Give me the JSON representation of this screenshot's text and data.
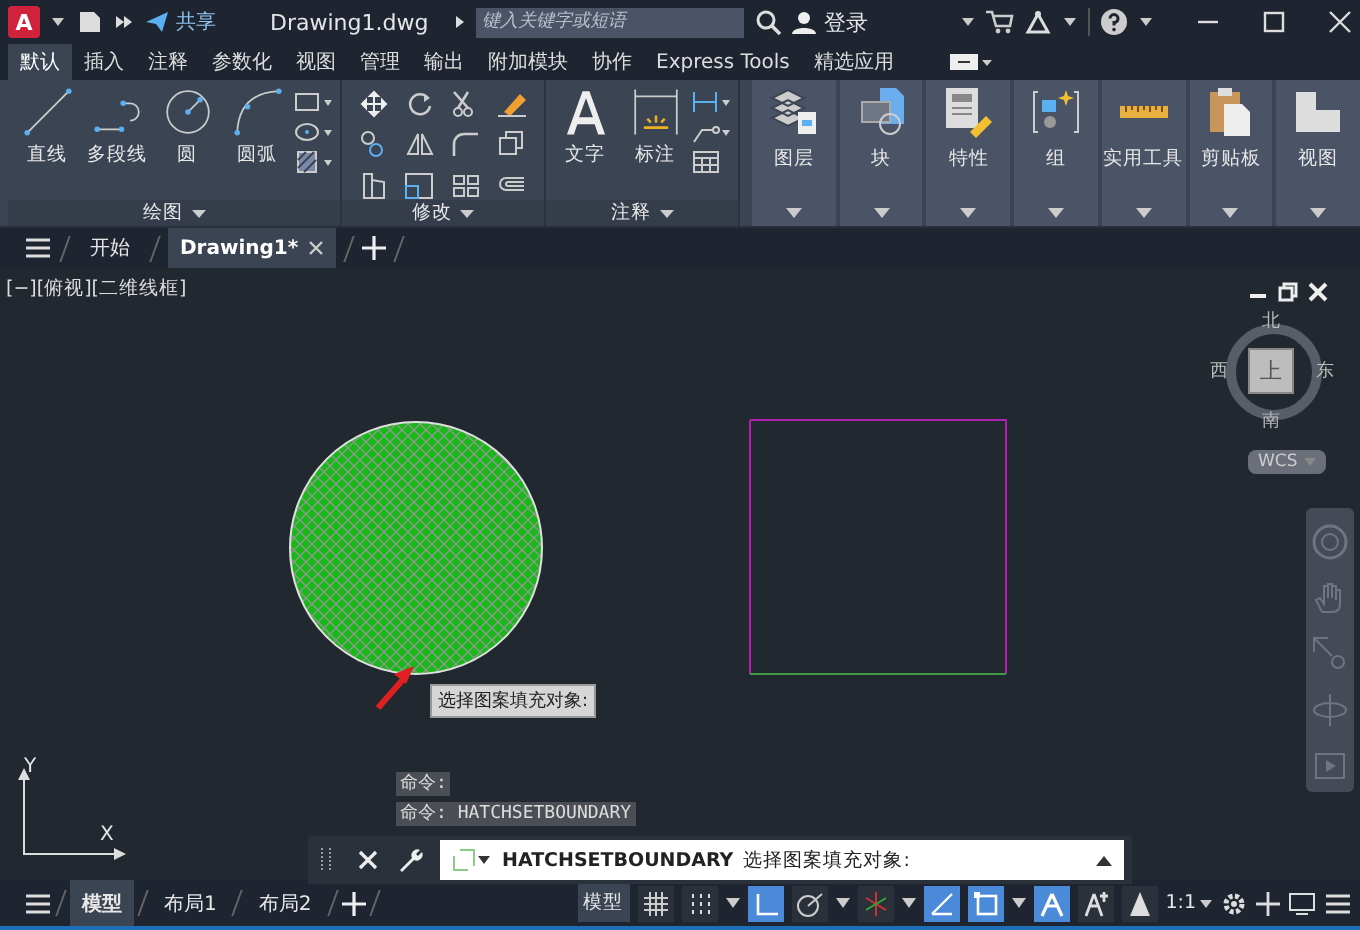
{
  "title_bar": {
    "app_letter": "A",
    "share": "共享",
    "title": "Drawing1.dwg",
    "search_placeholder": "键入关键字或短语",
    "sign_in": "登录"
  },
  "ribbon_tabs": [
    {
      "label": "默认",
      "selected": true
    },
    {
      "label": "插入",
      "selected": false
    },
    {
      "label": "注释",
      "selected": false
    },
    {
      "label": "参数化",
      "selected": false
    },
    {
      "label": "视图",
      "selected": false
    },
    {
      "label": "管理",
      "selected": false
    },
    {
      "label": "输出",
      "selected": false
    },
    {
      "label": "附加模块",
      "selected": false
    },
    {
      "label": "协作",
      "selected": false
    },
    {
      "label": "Express Tools",
      "selected": false
    },
    {
      "label": "精选应用",
      "selected": false
    }
  ],
  "draw_panel": {
    "title": "绘图",
    "tools": [
      {
        "kind": "line",
        "label": "直线"
      },
      {
        "kind": "polyline",
        "label": "多段线"
      },
      {
        "kind": "circle",
        "label": "圆"
      },
      {
        "kind": "arc",
        "label": "圆弧"
      }
    ]
  },
  "modify_panel": {
    "title": "修改"
  },
  "annotate_panel": {
    "title": "注释",
    "tools": [
      {
        "kind": "text",
        "label": "文字"
      },
      {
        "kind": "dimension",
        "label": "标注"
      }
    ]
  },
  "big_panels": [
    {
      "kind": "layers",
      "label": "图层"
    },
    {
      "kind": "block",
      "label": "块"
    },
    {
      "kind": "properties",
      "label": "特性"
    },
    {
      "kind": "group",
      "label": "组"
    },
    {
      "kind": "utilities",
      "label": "实用工具"
    },
    {
      "kind": "clipboard",
      "label": "剪贴板"
    },
    {
      "kind": "view",
      "label": "视图"
    }
  ],
  "doc_tabs": [
    {
      "label": "开始",
      "selected": false
    },
    {
      "label": "Drawing1*",
      "selected": true
    }
  ],
  "viewport": {
    "label": "[−][俯视][二维线框]",
    "compass": {
      "top": "上",
      "north": "北",
      "south": "南",
      "east": "东",
      "west": "西"
    },
    "ucs_name": "WCS",
    "tooltip": "选择图案填充对象:",
    "axis_y": "Y",
    "axis_x": "X"
  },
  "command": {
    "history": [
      "命令:",
      "命令: HATCHSETBOUNDARY"
    ],
    "prompt_command": "HATCHSETBOUNDARY",
    "prompt_text": "选择图案填充对象:"
  },
  "layout_tabs": [
    {
      "label": "模型",
      "selected": true
    },
    {
      "label": "布局1",
      "selected": false
    },
    {
      "label": "布局2",
      "selected": false
    }
  ],
  "status_bar": {
    "model": "模型",
    "scale": "1:1",
    "toggles": [
      {
        "kind": "grid",
        "on": false
      },
      {
        "kind": "snap",
        "on": false
      },
      {
        "kind": "ortho",
        "on": true
      },
      {
        "kind": "polar",
        "on": false
      },
      {
        "kind": "isometric",
        "on": false
      },
      {
        "kind": "track",
        "on": true
      },
      {
        "kind": "osnap",
        "on": true
      },
      {
        "kind": "annotation",
        "on": true
      },
      {
        "kind": "autoscale",
        "on": false
      },
      {
        "kind": "annoscale",
        "on": false
      }
    ]
  }
}
